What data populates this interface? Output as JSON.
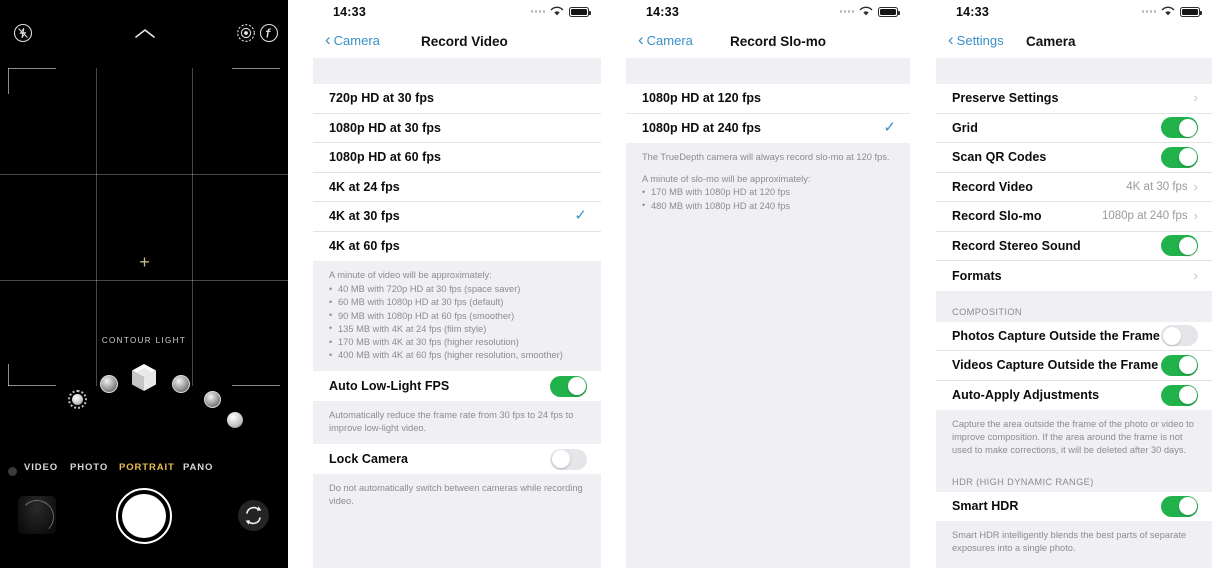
{
  "camera_viewfinder": {
    "icons": {
      "flash": "flash-off-icon",
      "chevron_up": "chevron-up-icon",
      "live_photo": "live-photo-icon",
      "filters": "filters-icon",
      "flip_camera": "flip-camera-icon"
    },
    "lighting_label": "CONTOUR LIGHT",
    "modes": [
      {
        "label": "VIDEO",
        "active": false
      },
      {
        "label": "PHOTO",
        "active": false
      },
      {
        "label": "PORTRAIT",
        "active": true
      },
      {
        "label": "PANO",
        "active": false
      }
    ],
    "accent_active_color": "#e8bf52"
  },
  "panel_record_video": {
    "status": {
      "time": "14:33"
    },
    "nav": {
      "back": "Camera",
      "title": "Record Video"
    },
    "options": [
      {
        "label": "720p HD at 30 fps",
        "selected": false
      },
      {
        "label": "1080p HD at 30 fps",
        "selected": false
      },
      {
        "label": "1080p HD at 60 fps",
        "selected": false
      },
      {
        "label": "4K at 24 fps",
        "selected": false
      },
      {
        "label": "4K at 30 fps",
        "selected": true
      },
      {
        "label": "4K at 60 fps",
        "selected": false
      }
    ],
    "footnote_title": "A minute of video will be approximately:",
    "footnote_items": [
      "40 MB with 720p HD at 30 fps (space saver)",
      "60 MB with 1080p HD at 30 fps (default)",
      "90 MB with 1080p HD at 60 fps (smoother)",
      "135 MB with 4K at 24 fps (film style)",
      "170 MB with 4K at 30 fps (higher resolution)",
      "400 MB with 4K at 60 fps (higher resolution, smoother)"
    ],
    "auto_low_light": {
      "label": "Auto Low-Light FPS",
      "on": true
    },
    "auto_low_light_note": "Automatically reduce the frame rate from 30 fps to 24 fps to improve low-light video.",
    "lock_camera": {
      "label": "Lock Camera",
      "on": false
    },
    "lock_camera_note": "Do not automatically switch between cameras while recording video."
  },
  "panel_record_slomo": {
    "status": {
      "time": "14:33"
    },
    "nav": {
      "back": "Camera",
      "title": "Record Slo-mo"
    },
    "options": [
      {
        "label": "1080p HD at 120 fps",
        "selected": false
      },
      {
        "label": "1080p HD at 240 fps",
        "selected": true
      }
    ],
    "footnote_line1": "The TrueDepth camera will always record slo-mo at 120 fps.",
    "footnote_title": "A minute of slo-mo will be approximately:",
    "footnote_items": [
      "170 MB with 1080p HD at 120 fps",
      "480 MB with 1080p HD at 240 fps"
    ]
  },
  "panel_camera_settings": {
    "status": {
      "time": "14:33"
    },
    "nav": {
      "back": "Settings",
      "title": "Camera"
    },
    "main_rows": [
      {
        "label": "Preserve Settings",
        "type": "chevron",
        "value": ""
      },
      {
        "label": "Grid",
        "type": "toggle",
        "on": true
      },
      {
        "label": "Scan QR Codes",
        "type": "toggle",
        "on": true
      },
      {
        "label": "Record Video",
        "type": "chevron",
        "value": "4K at 30 fps"
      },
      {
        "label": "Record Slo-mo",
        "type": "chevron",
        "value": "1080p at 240 fps"
      },
      {
        "label": "Record Stereo Sound",
        "type": "toggle",
        "on": true
      },
      {
        "label": "Formats",
        "type": "chevron",
        "value": ""
      }
    ],
    "composition_header": "COMPOSITION",
    "composition_rows": [
      {
        "label": "Photos Capture Outside the Frame",
        "type": "toggle",
        "on": false
      },
      {
        "label": "Videos Capture Outside the Frame",
        "type": "toggle",
        "on": true
      },
      {
        "label": "Auto-Apply Adjustments",
        "type": "toggle",
        "on": true
      }
    ],
    "composition_note": "Capture the area outside the frame of the photo or video to improve composition. If the area around the frame is not used to make corrections, it will be deleted after 30 days.",
    "hdr_header": "HDR (HIGH DYNAMIC RANGE)",
    "hdr_rows": [
      {
        "label": "Smart HDR",
        "type": "toggle",
        "on": true
      }
    ],
    "hdr_note": "Smart HDR intelligently blends the best parts of separate exposures into a single photo."
  },
  "colors": {
    "ios_blue": "#3a8fc8",
    "toggle_green": "#22b24c",
    "toggle_off": "#e6e6ea",
    "group_bg": "#efeff4"
  }
}
